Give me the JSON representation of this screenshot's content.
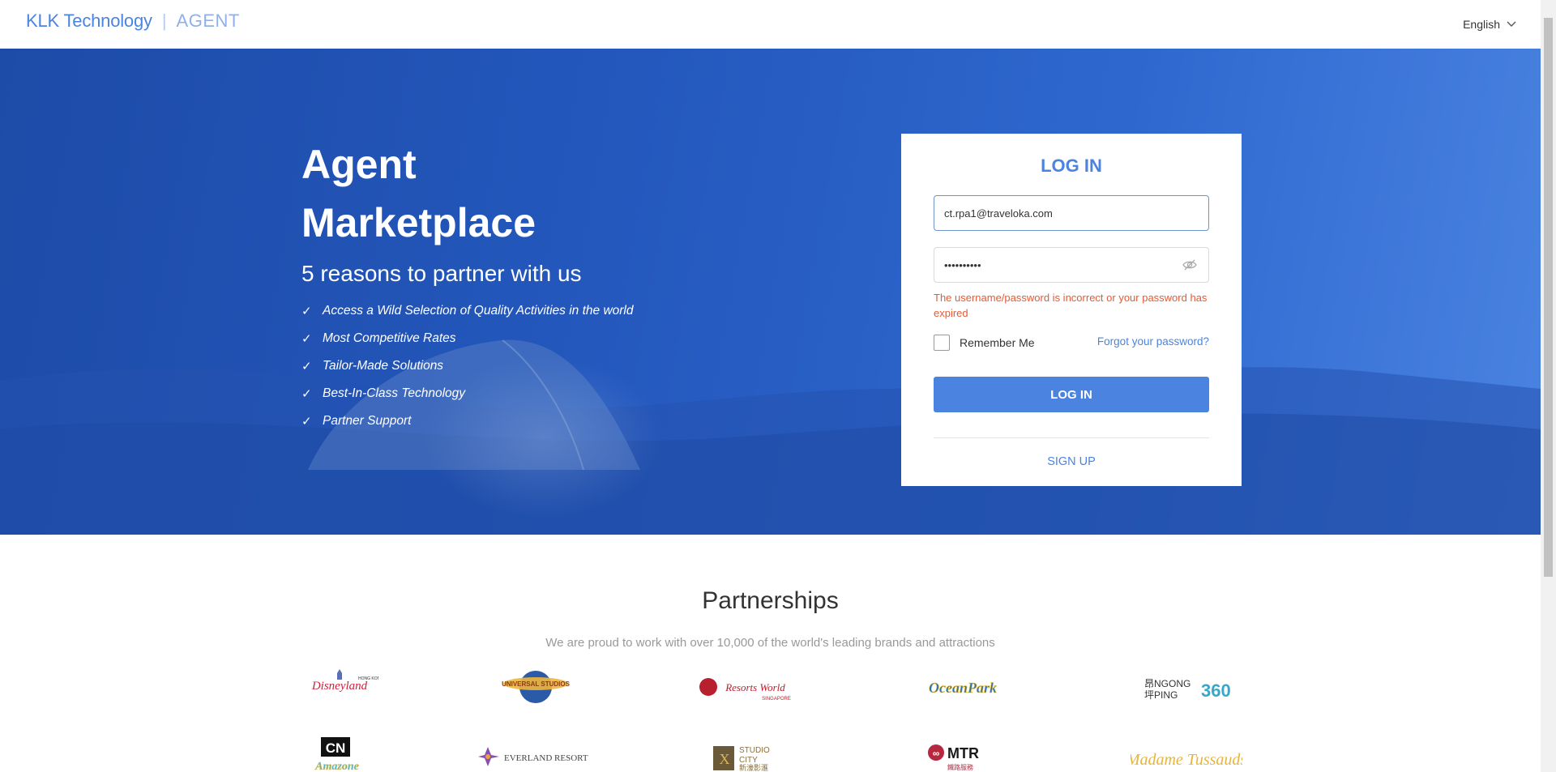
{
  "header": {
    "brand_name": "KLK Technology",
    "brand_separator": "|",
    "brand_product": "AGENT",
    "language": "English"
  },
  "hero": {
    "title_line1": "Agent",
    "title_line2": "Marketplace",
    "subtitle": "5 reasons to partner with us",
    "reasons": [
      "Access a Wild Selection of Quality Activities in the world",
      "Most Competitive Rates",
      "Tailor-Made Solutions",
      "Best-In-Class Technology",
      "Partner Support"
    ]
  },
  "login": {
    "title": "LOG IN",
    "email_value": "ct.rpa1@traveloka.com",
    "password_value": "••••••••••",
    "error": "The username/password is incorrect or your password has expired",
    "remember_label": "Remember Me",
    "forgot_label": "Forgot your password?",
    "submit_label": "LOG IN",
    "signup_label": "SIGN UP"
  },
  "partnerships": {
    "title": "Partnerships",
    "subtitle": "We are proud to work with over 10,000 of the world's leading brands and attractions",
    "logos": [
      "Hong Kong Disneyland",
      "Universal Studios",
      "Resorts World Singapore",
      "Ocean Park",
      "Ngong Ping 360",
      "Cartoon Network Amazone",
      "Everland Resort",
      "Studio City Macau",
      "MTR",
      "Madame Tussauds"
    ]
  },
  "colors": {
    "accent": "#4a84e0",
    "error": "#e55a34",
    "hero_dark": "#1d4ba8",
    "hero_light": "#4a83e0"
  }
}
